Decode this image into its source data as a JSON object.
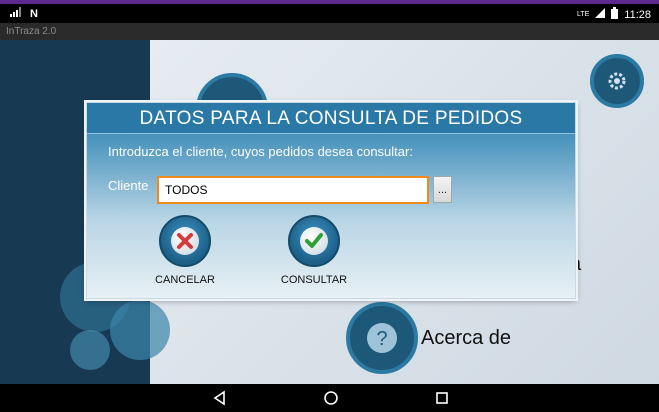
{
  "status_bar": {
    "time": "11:28",
    "sim_badge": "N",
    "net_badge": "LTE"
  },
  "app": {
    "title": "InTraza 2.0"
  },
  "background": {
    "about_label": "Acerca de",
    "partial_label": "a"
  },
  "dialog": {
    "title": "DATOS PARA LA CONSULTA DE PEDIDOS",
    "instruction": "Introduzca el cliente, cuyos pedidos desea consultar:",
    "client_label": "Cliente",
    "client_value": "TODOS",
    "browse_label": "...",
    "cancel_label": "CANCELAR",
    "consult_label": "CONSULTAR"
  },
  "colors": {
    "accent_orange": "#f08a1c",
    "title_blue": "#2a78a6",
    "cancel_red": "#d63b3b",
    "consult_green": "#2fa134"
  }
}
